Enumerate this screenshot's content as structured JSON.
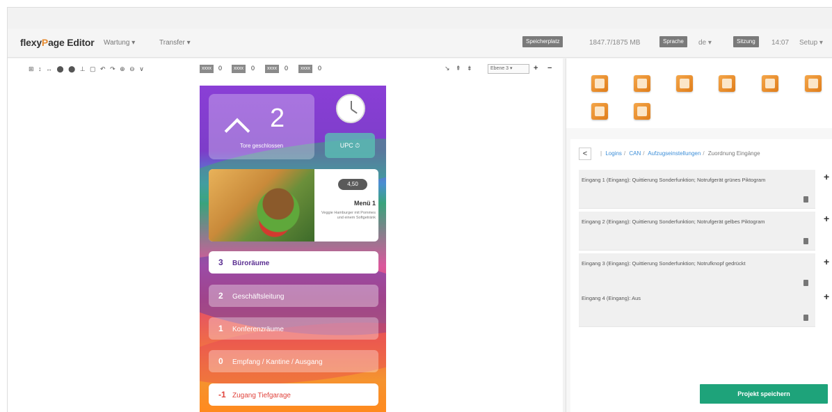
{
  "header": {
    "logo_prefix": "flexy",
    "logo_p": "P",
    "logo_suffix": "age Editor",
    "menu_wartung": "Wartung ▾",
    "menu_transfer": "Transfer ▾",
    "badge_speicher": "Speicherplatz",
    "storage_value": "1847.7/1875 MB",
    "badge_sprache": "Sprache",
    "language": "de ▾",
    "badge_sitzung": "Sitzung",
    "time": "14:07",
    "setup": "Setup ▾"
  },
  "editor_toolbar": {
    "icons": "⊞ ↕ ↔ ⬤ ⬤ ⊥ ▢  ↶ ↷  ⊕ ⊖ ∨",
    "box1": "xxxx",
    "val1": "0",
    "box2": "xxxx",
    "val2": "0",
    "box3": "xxxx",
    "val3": "0",
    "box4": "xxxx",
    "val4": "0",
    "right_icons": "↘ ⇞ ⇟",
    "ebene": "Ebene 3 ▾",
    "plus": "+",
    "minus": "−"
  },
  "phone": {
    "floor_number": "2",
    "floor_label": "Tore geschlossen",
    "upc_label": "UPC ⏱",
    "food_price": "4,50",
    "food_title": "Menü 1",
    "food_desc": "Veggie Hamburger mit Pommes und einem Softgetränk",
    "rows": [
      {
        "num": "3",
        "label": "Büroräume"
      },
      {
        "num": "2",
        "label": "Geschäftsleitung"
      },
      {
        "num": "1",
        "label": "Konferenzräume"
      },
      {
        "num": "0",
        "label": "Empfang / Kantine / Ausgang"
      },
      {
        "num": "-1",
        "label": "Zugang Tiefgarage"
      }
    ]
  },
  "right_panel": {
    "breadcrumb": {
      "back": "<",
      "items": [
        "Logins",
        "CAN",
        "Aufzugseinstellungen"
      ],
      "current": "Zuordnung Eingänge"
    },
    "entries": [
      "Eingang 1 (Eingang): Quittierung Sonderfunktion; Notrufgerät grünes Piktogram",
      "Eingang 2 (Eingang): Quittierung Sonderfunktion; Notrufgerät gelbes Piktogram",
      "Eingang 3 (Eingang): Quittierung Sonderfunktion; Notrufknopf gedrückt",
      "Eingang 4 (Eingang): Aus"
    ],
    "plus": "+",
    "save_label": "Projekt speichern"
  },
  "colors": {
    "accent_orange": "#e5892e",
    "save_green": "#1ea37a",
    "link_blue": "#3c8ed8"
  }
}
